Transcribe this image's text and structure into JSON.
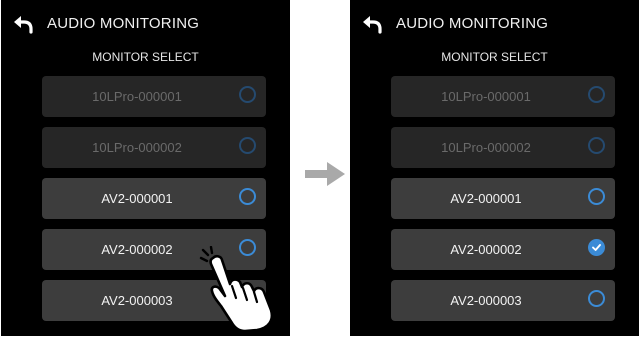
{
  "colors": {
    "accent": "#3b8bd6",
    "screen_bg": "#000000",
    "row_bg": "#3d3d3d",
    "row_disabled_bg": "#262626"
  },
  "before": {
    "title": "AUDIO MONITORING",
    "subtitle": "MONITOR SELECT",
    "items": [
      {
        "label": "10LPro-000001",
        "disabled": true,
        "selected": false
      },
      {
        "label": "10LPro-000002",
        "disabled": true,
        "selected": false
      },
      {
        "label": "AV2-000001",
        "disabled": false,
        "selected": false
      },
      {
        "label": "AV2-000002",
        "disabled": false,
        "selected": false
      },
      {
        "label": "AV2-000003",
        "disabled": false,
        "selected": false
      }
    ]
  },
  "after": {
    "title": "AUDIO MONITORING",
    "subtitle": "MONITOR SELECT",
    "items": [
      {
        "label": "10LPro-000001",
        "disabled": true,
        "selected": false
      },
      {
        "label": "10LPro-000002",
        "disabled": true,
        "selected": false
      },
      {
        "label": "AV2-000001",
        "disabled": false,
        "selected": false
      },
      {
        "label": "AV2-000002",
        "disabled": false,
        "selected": true
      },
      {
        "label": "AV2-000003",
        "disabled": false,
        "selected": false
      }
    ]
  },
  "icons": {
    "back": "back-arrow-icon",
    "check": "check-icon",
    "transition": "arrow-right-icon",
    "tap": "tapping-hand-icon"
  }
}
